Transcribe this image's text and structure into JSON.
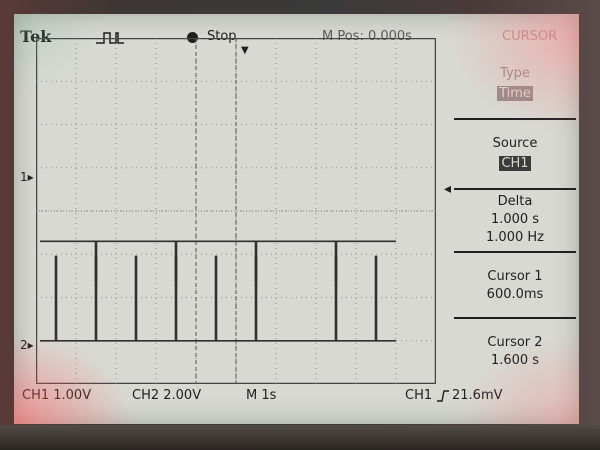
{
  "header": {
    "brand": "Tek",
    "acquire_icon": "square-pulse-icon",
    "run_state": "Stop",
    "mpos_label": "M Pos: 0.000s",
    "menu_title": "CURSOR"
  },
  "side_menu": {
    "type": {
      "label": "Type",
      "value": "Time"
    },
    "source": {
      "label": "Source",
      "value": "CH1"
    },
    "delta": {
      "label": "Delta",
      "time": "1.000 s",
      "freq": "1.000 Hz"
    },
    "cursor1": {
      "label": "Cursor 1",
      "value": "600.0ms"
    },
    "cursor2": {
      "label": "Cursor 2",
      "value": "1.600 s"
    }
  },
  "markers": {
    "ch1": "1",
    "ch2": "2"
  },
  "bottom": {
    "ch1_scale": "CH1  1.00V",
    "ch2_scale": "CH2  2.00V",
    "timebase": "M  1s",
    "trigger_source": "CH1",
    "trigger_icon": "rising-edge-icon",
    "trigger_level": "21.6mV"
  },
  "waveforms": {
    "time_per_div": 1,
    "ch1": {
      "baseline_div": 3.3,
      "pulse_depth_div": 0.9,
      "pulse_times_s": [
        1.5,
        3.5,
        5.5,
        7.5
      ]
    },
    "ch2": {
      "baseline_div": 1.0,
      "pulse_height_div": 1.95,
      "pulse_times_s": [
        0.5,
        1.5,
        2.5,
        3.5,
        4.5,
        5.5,
        7.5,
        8.5
      ]
    },
    "record_end_s": 9.0
  },
  "cursors_s": [
    4.0,
    5.0
  ]
}
